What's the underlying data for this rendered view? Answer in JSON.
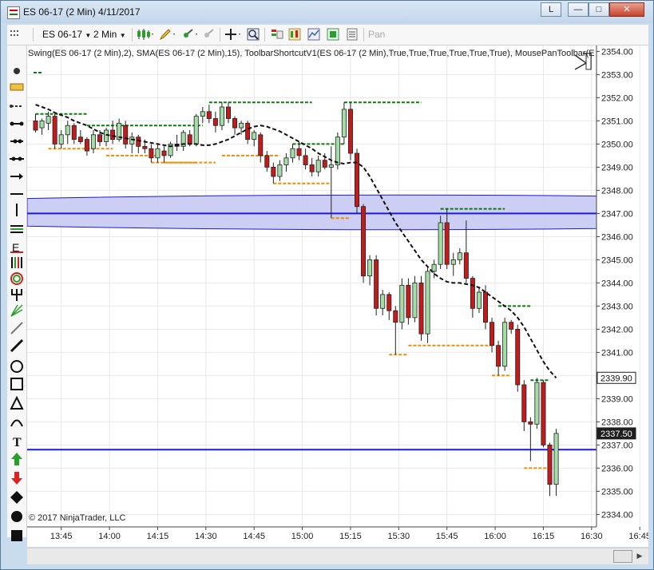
{
  "window": {
    "title": "ES 06-17 (2 Min)  4/11/2017",
    "help_label": "L",
    "minimize_glyph": "—",
    "maximize_glyph": "□",
    "close_glyph": "✕"
  },
  "toolbar": {
    "instrument": "ES 06-17",
    "interval": "2 Min",
    "pan_label": "Pan"
  },
  "indicator_label": "Swing(ES 06-17 (2 Min),2), SMA(ES 06-17 (2 Min),15), ToolbarShortcutV1(ES 06-17 (2 Min),True,True,True,True,True,True), MousePanToolbar(E",
  "copyright": "© 2017 NinjaTrader, LLC",
  "icons": {
    "drawing_tools": [
      "pointer-icon",
      "ruler-icon",
      "risk-reward-icon",
      "line-icon",
      "ray-icon",
      "extended-line-icon",
      "arrow-line-icon",
      "horizontal-line-icon",
      "vertical-line-icon",
      "channel-icon",
      "fibonacci-extension-icon",
      "fibonacci-levels-icon",
      "fibonacci-circle-icon",
      "pitchfork-icon",
      "gann-fan-icon",
      "regression-channel-icon",
      "trend-channel-icon",
      "ellipse-icon",
      "rectangle-icon",
      "triangle-icon",
      "arc-icon",
      "text-icon",
      "arrow-up-icon",
      "arrow-down-icon",
      "diamond-icon",
      "dot-icon",
      "square-icon"
    ]
  },
  "colors": {
    "up_candle": "#a6dca6",
    "down_candle": "#c21b1b",
    "zone_fill": "#c9cbf3",
    "zone_line": "#1b1bd6",
    "swing_high": "#0d7a0d",
    "swing_low": "#f08c00",
    "sma": "#111111",
    "current_price_bg": "#1e1e1e"
  },
  "chart_data": {
    "type": "candlestick",
    "instrument": "ES 06-17",
    "interval": "2 Min",
    "date": "4/11/2017",
    "ylim": [
      2333.65,
      2354.15
    ],
    "y_ticks": [
      "2354.00",
      "2353.00",
      "2352.00",
      "2351.00",
      "2350.00",
      "2349.00",
      "2348.00",
      "2347.00",
      "2346.00",
      "2345.00",
      "2344.00",
      "2343.00",
      "2342.00",
      "2341.00",
      "2340.00",
      "2339.00",
      "2338.00",
      "2337.00",
      "2336.00",
      "2335.00",
      "2334.00"
    ],
    "x_ticks": [
      "13:45",
      "14:00",
      "14:15",
      "14:30",
      "14:45",
      "15:00",
      "15:15",
      "15:30",
      "15:45",
      "16:00",
      "16:15",
      "16:30",
      "16:45"
    ],
    "price_labels": [
      {
        "text": "2339.90",
        "value": 2339.9,
        "style": "current"
      },
      {
        "text": "2337.50",
        "value": 2337.5,
        "style": "marker"
      }
    ],
    "candles": [
      {
        "o": 2351.0,
        "h": 2351.3,
        "l": 2350.5,
        "c": 2350.6
      },
      {
        "o": 2350.7,
        "h": 2351.1,
        "l": 2350.4,
        "c": 2351.0
      },
      {
        "o": 2350.9,
        "h": 2351.4,
        "l": 2350.6,
        "c": 2351.2
      },
      {
        "o": 2351.2,
        "h": 2351.3,
        "l": 2349.8,
        "c": 2350.0
      },
      {
        "o": 2350.0,
        "h": 2350.6,
        "l": 2349.8,
        "c": 2350.4
      },
      {
        "o": 2350.4,
        "h": 2351.0,
        "l": 2350.0,
        "c": 2350.8
      },
      {
        "o": 2350.8,
        "h": 2350.9,
        "l": 2350.0,
        "c": 2350.2
      },
      {
        "o": 2350.3,
        "h": 2350.6,
        "l": 2350.0,
        "c": 2350.1
      },
      {
        "o": 2350.2,
        "h": 2350.3,
        "l": 2349.5,
        "c": 2349.7
      },
      {
        "o": 2349.8,
        "h": 2350.6,
        "l": 2349.6,
        "c": 2350.4
      },
      {
        "o": 2350.4,
        "h": 2350.6,
        "l": 2349.9,
        "c": 2350.1
      },
      {
        "o": 2350.1,
        "h": 2350.7,
        "l": 2349.9,
        "c": 2350.6
      },
      {
        "o": 2350.6,
        "h": 2351.0,
        "l": 2350.0,
        "c": 2350.2
      },
      {
        "o": 2350.2,
        "h": 2351.1,
        "l": 2350.1,
        "c": 2350.9
      },
      {
        "o": 2350.8,
        "h": 2351.0,
        "l": 2349.8,
        "c": 2350.0
      },
      {
        "o": 2350.0,
        "h": 2350.5,
        "l": 2349.6,
        "c": 2350.3
      },
      {
        "o": 2350.3,
        "h": 2350.4,
        "l": 2349.6,
        "c": 2349.9
      },
      {
        "o": 2349.9,
        "h": 2350.2,
        "l": 2349.6,
        "c": 2349.8
      },
      {
        "o": 2349.8,
        "h": 2350.0,
        "l": 2349.2,
        "c": 2349.4
      },
      {
        "o": 2349.4,
        "h": 2350.0,
        "l": 2349.2,
        "c": 2349.8
      },
      {
        "o": 2349.7,
        "h": 2349.9,
        "l": 2349.2,
        "c": 2349.5
      },
      {
        "o": 2349.5,
        "h": 2350.1,
        "l": 2349.4,
        "c": 2350.0
      },
      {
        "o": 2350.0,
        "h": 2350.4,
        "l": 2349.7,
        "c": 2349.9
      },
      {
        "o": 2349.9,
        "h": 2350.6,
        "l": 2349.7,
        "c": 2350.5
      },
      {
        "o": 2350.4,
        "h": 2350.6,
        "l": 2349.9,
        "c": 2350.0
      },
      {
        "o": 2350.0,
        "h": 2351.3,
        "l": 2349.9,
        "c": 2351.2
      },
      {
        "o": 2351.2,
        "h": 2351.6,
        "l": 2350.9,
        "c": 2351.4
      },
      {
        "o": 2351.4,
        "h": 2351.7,
        "l": 2350.9,
        "c": 2351.1
      },
      {
        "o": 2351.1,
        "h": 2351.4,
        "l": 2350.5,
        "c": 2350.8
      },
      {
        "o": 2350.8,
        "h": 2351.8,
        "l": 2350.6,
        "c": 2351.6
      },
      {
        "o": 2351.6,
        "h": 2351.8,
        "l": 2350.9,
        "c": 2351.1
      },
      {
        "o": 2351.1,
        "h": 2351.2,
        "l": 2350.4,
        "c": 2350.7
      },
      {
        "o": 2350.7,
        "h": 2351.0,
        "l": 2350.4,
        "c": 2350.9
      },
      {
        "o": 2350.9,
        "h": 2351.0,
        "l": 2350.0,
        "c": 2350.2
      },
      {
        "o": 2350.2,
        "h": 2350.6,
        "l": 2349.9,
        "c": 2350.5
      },
      {
        "o": 2350.4,
        "h": 2350.5,
        "l": 2349.2,
        "c": 2349.5
      },
      {
        "o": 2349.5,
        "h": 2349.7,
        "l": 2348.8,
        "c": 2349.0
      },
      {
        "o": 2349.0,
        "h": 2349.2,
        "l": 2348.3,
        "c": 2348.6
      },
      {
        "o": 2348.6,
        "h": 2349.3,
        "l": 2348.4,
        "c": 2349.1
      },
      {
        "o": 2349.1,
        "h": 2349.6,
        "l": 2348.8,
        "c": 2349.4
      },
      {
        "o": 2349.4,
        "h": 2350.0,
        "l": 2349.2,
        "c": 2349.8
      },
      {
        "o": 2349.8,
        "h": 2350.1,
        "l": 2349.3,
        "c": 2349.5
      },
      {
        "o": 2349.5,
        "h": 2349.8,
        "l": 2348.9,
        "c": 2349.1
      },
      {
        "o": 2349.1,
        "h": 2349.4,
        "l": 2348.6,
        "c": 2348.8
      },
      {
        "o": 2348.8,
        "h": 2349.5,
        "l": 2348.6,
        "c": 2349.3
      },
      {
        "o": 2349.3,
        "h": 2349.6,
        "l": 2348.9,
        "c": 2349.0
      },
      {
        "o": 2349.0,
        "h": 2349.9,
        "l": 2346.8,
        "c": 2349.1
      },
      {
        "o": 2349.1,
        "h": 2350.5,
        "l": 2348.9,
        "c": 2350.3
      },
      {
        "o": 2350.3,
        "h": 2351.8,
        "l": 2350.0,
        "c": 2351.5
      },
      {
        "o": 2351.5,
        "h": 2351.8,
        "l": 2349.3,
        "c": 2349.6
      },
      {
        "o": 2349.6,
        "h": 2349.8,
        "l": 2347.0,
        "c": 2347.3
      },
      {
        "o": 2347.3,
        "h": 2347.4,
        "l": 2344.0,
        "c": 2344.3
      },
      {
        "o": 2344.3,
        "h": 2345.2,
        "l": 2343.9,
        "c": 2345.0
      },
      {
        "o": 2345.0,
        "h": 2345.2,
        "l": 2342.6,
        "c": 2342.9
      },
      {
        "o": 2342.9,
        "h": 2343.7,
        "l": 2342.6,
        "c": 2343.5
      },
      {
        "o": 2343.5,
        "h": 2343.6,
        "l": 2342.4,
        "c": 2342.8
      },
      {
        "o": 2342.8,
        "h": 2343.0,
        "l": 2340.9,
        "c": 2342.3
      },
      {
        "o": 2342.3,
        "h": 2344.2,
        "l": 2342.0,
        "c": 2343.9
      },
      {
        "o": 2343.9,
        "h": 2344.2,
        "l": 2342.2,
        "c": 2342.5
      },
      {
        "o": 2342.5,
        "h": 2344.3,
        "l": 2342.3,
        "c": 2344.0
      },
      {
        "o": 2344.0,
        "h": 2344.3,
        "l": 2341.5,
        "c": 2341.8
      },
      {
        "o": 2341.8,
        "h": 2344.7,
        "l": 2341.4,
        "c": 2344.5
      },
      {
        "o": 2344.5,
        "h": 2345.0,
        "l": 2344.2,
        "c": 2344.8
      },
      {
        "o": 2344.8,
        "h": 2346.9,
        "l": 2344.6,
        "c": 2346.6
      },
      {
        "o": 2346.6,
        "h": 2347.2,
        "l": 2344.6,
        "c": 2344.8
      },
      {
        "o": 2344.8,
        "h": 2345.3,
        "l": 2344.3,
        "c": 2345.0
      },
      {
        "o": 2345.0,
        "h": 2345.5,
        "l": 2344.8,
        "c": 2345.3
      },
      {
        "o": 2345.3,
        "h": 2346.7,
        "l": 2344.0,
        "c": 2344.2
      },
      {
        "o": 2344.2,
        "h": 2344.3,
        "l": 2342.5,
        "c": 2342.9
      },
      {
        "o": 2342.9,
        "h": 2343.8,
        "l": 2342.7,
        "c": 2343.6
      },
      {
        "o": 2343.6,
        "h": 2343.9,
        "l": 2342.0,
        "c": 2342.3
      },
      {
        "o": 2342.3,
        "h": 2342.5,
        "l": 2341.0,
        "c": 2341.3
      },
      {
        "o": 2341.3,
        "h": 2341.5,
        "l": 2340.0,
        "c": 2340.4
      },
      {
        "o": 2340.4,
        "h": 2342.5,
        "l": 2340.2,
        "c": 2342.3
      },
      {
        "o": 2342.3,
        "h": 2342.4,
        "l": 2341.8,
        "c": 2342.0
      },
      {
        "o": 2342.0,
        "h": 2342.2,
        "l": 2339.3,
        "c": 2339.6
      },
      {
        "o": 2339.6,
        "h": 2339.8,
        "l": 2337.6,
        "c": 2338.0
      },
      {
        "o": 2338.0,
        "h": 2338.2,
        "l": 2336.3,
        "c": 2337.9
      },
      {
        "o": 2337.9,
        "h": 2339.9,
        "l": 2337.7,
        "c": 2339.7
      },
      {
        "o": 2339.7,
        "h": 2339.8,
        "l": 2336.9,
        "c": 2337.0
      },
      {
        "o": 2337.0,
        "h": 2337.1,
        "l": 2334.8,
        "c": 2335.3
      },
      {
        "o": 2335.3,
        "h": 2337.7,
        "l": 2334.8,
        "c": 2337.5
      }
    ],
    "sma_15": [
      2351.7,
      2351.6,
      2351.5,
      2351.35,
      2351.25,
      2351.15,
      2351.0,
      2350.9,
      2350.8,
      2350.65,
      2350.5,
      2350.4,
      2350.35,
      2350.3,
      2350.25,
      2350.2,
      2350.15,
      2350.1,
      2350.05,
      2350.0,
      2349.95,
      2349.9,
      2349.95,
      2350.0,
      2350.0,
      2350.0,
      2349.95,
      2349.95,
      2350.0,
      2350.1,
      2350.2,
      2350.35,
      2350.5,
      2350.65,
      2350.75,
      2350.8,
      2350.75,
      2350.65,
      2350.55,
      2350.4,
      2350.25,
      2350.1,
      2349.95,
      2349.8,
      2349.6,
      2349.45,
      2349.3,
      2349.2,
      2349.15,
      2349.2,
      2349.2,
      2349.0,
      2348.6,
      2348.1,
      2347.6,
      2347.1,
      2346.6,
      2346.2,
      2345.8,
      2345.4,
      2345.0,
      2344.7,
      2344.4,
      2344.2,
      2344.05,
      2344.0,
      2344.0,
      2343.95,
      2343.9,
      2343.8,
      2343.6,
      2343.4,
      2343.2,
      2343.0,
      2342.8,
      2342.5,
      2342.1,
      2341.6,
      2341.1,
      2340.6,
      2340.2,
      2339.9
    ],
    "swing_highs": [
      {
        "value": 2351.3,
        "from": 0,
        "to": 8
      },
      {
        "value": 2350.8,
        "from": 8,
        "to": 26
      },
      {
        "value": 2351.8,
        "from": 27,
        "to": 43
      },
      {
        "value": 2350.0,
        "from": 40,
        "to": 48
      },
      {
        "value": 2351.8,
        "from": 48,
        "to": 60
      },
      {
        "value": 2347.2,
        "from": 63,
        "to": 73
      },
      {
        "value": 2343.0,
        "from": 72,
        "to": 77
      },
      {
        "value": 2339.8,
        "from": 77,
        "to": 80
      }
    ],
    "swing_lows": [
      {
        "value": 2349.8,
        "from": 2,
        "to": 12
      },
      {
        "value": 2349.5,
        "from": 11,
        "to": 19
      },
      {
        "value": 2349.2,
        "from": 18,
        "to": 28
      },
      {
        "value": 2349.2,
        "from": 20,
        "to": 25
      },
      {
        "value": 2349.5,
        "from": 29,
        "to": 38
      },
      {
        "value": 2348.3,
        "from": 37,
        "to": 46
      },
      {
        "value": 2346.8,
        "from": 46,
        "to": 49
      },
      {
        "value": 2340.9,
        "from": 55,
        "to": 58
      },
      {
        "value": 2341.3,
        "from": 58,
        "to": 71
      },
      {
        "value": 2340.0,
        "from": 71,
        "to": 74
      },
      {
        "value": 2336.0,
        "from": 76,
        "to": 80
      }
    ],
    "zone": {
      "top": 2347.75,
      "bottom": 2346.35,
      "line": 2347.0
    },
    "support_line": 2336.8
  }
}
